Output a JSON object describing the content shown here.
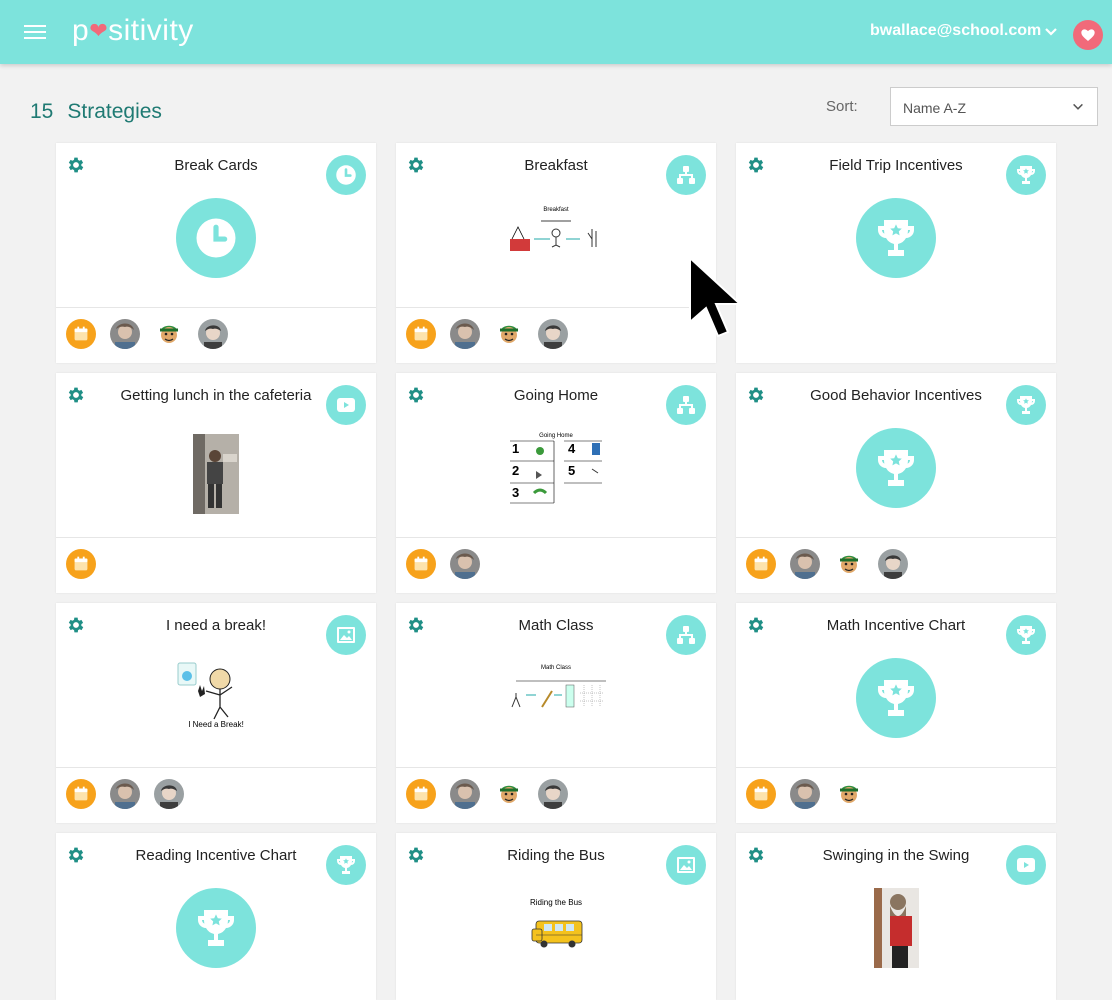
{
  "app": {
    "logo_text_pre": "p",
    "logo_text_post": "sitivity",
    "user_email": "bwallace@school.com"
  },
  "header": {
    "count": "15",
    "title": "Strategies",
    "sort_label": "Sort:",
    "sort_value": "Name A-Z"
  },
  "colors": {
    "teal": "#7de3dc",
    "teal_dark": "#1f7a73",
    "pink": "#f16a7a",
    "orange": "#f7a21b"
  },
  "cards": [
    {
      "title": "Break Cards",
      "type_icon": "clock-icon",
      "content": "clock-icon"
    },
    {
      "title": "Breakfast",
      "type_icon": "flow-icon",
      "content": "sequence-image"
    },
    {
      "title": "Field Trip Incentives",
      "type_icon": "trophy-icon",
      "content": "trophy-icon"
    },
    {
      "title": "Getting lunch in the cafeteria",
      "type_icon": "video-icon",
      "content": "photo"
    },
    {
      "title": "Going Home",
      "type_icon": "flow-icon",
      "content": "sequence-image"
    },
    {
      "title": "Good Behavior Incentives",
      "type_icon": "trophy-icon",
      "content": "trophy-icon"
    },
    {
      "title": "I need a break!",
      "type_icon": "image-icon",
      "content": "drawing"
    },
    {
      "title": "Math Class",
      "type_icon": "flow-icon",
      "content": "sequence-image"
    },
    {
      "title": "Math Incentive Chart",
      "type_icon": "trophy-icon",
      "content": "trophy-icon"
    },
    {
      "title": "Reading Incentive Chart",
      "type_icon": "trophy-icon",
      "content": "trophy-icon"
    },
    {
      "title": "Riding the Bus",
      "type_icon": "image-icon",
      "content": "drawing"
    },
    {
      "title": "Swinging in the Swing",
      "type_icon": "video-icon",
      "content": "photo"
    }
  ],
  "thumb_text": {
    "breakfast": "Breakfast",
    "going_home": "Going Home",
    "math": "Math Class",
    "need_break": "I Need a Break!",
    "bus": "Riding the Bus"
  }
}
